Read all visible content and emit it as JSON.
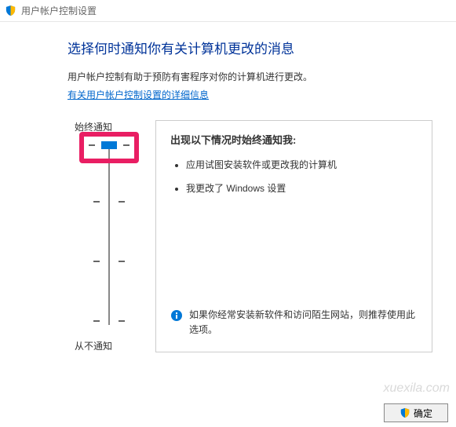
{
  "window": {
    "title": "用户帐户控制设置"
  },
  "page": {
    "heading": "选择何时通知你有关计算机更改的消息",
    "description": "用户帐户控制有助于预防有害程序对你的计算机进行更改。",
    "link_text": "有关用户帐户控制设置的详细信息"
  },
  "slider": {
    "top_label": "始终通知",
    "bottom_label": "从不通知",
    "level": 3,
    "levels_count": 4
  },
  "info": {
    "title": "出现以下情况时始终通知我:",
    "bullets": [
      "应用试图安装软件或更改我的计算机",
      "我更改了 Windows 设置"
    ],
    "recommend": "如果你经常安装新软件和访问陌生网站，则推荐使用此选项。"
  },
  "footer": {
    "ok_label": "确定"
  },
  "watermark": "xuexila.com"
}
